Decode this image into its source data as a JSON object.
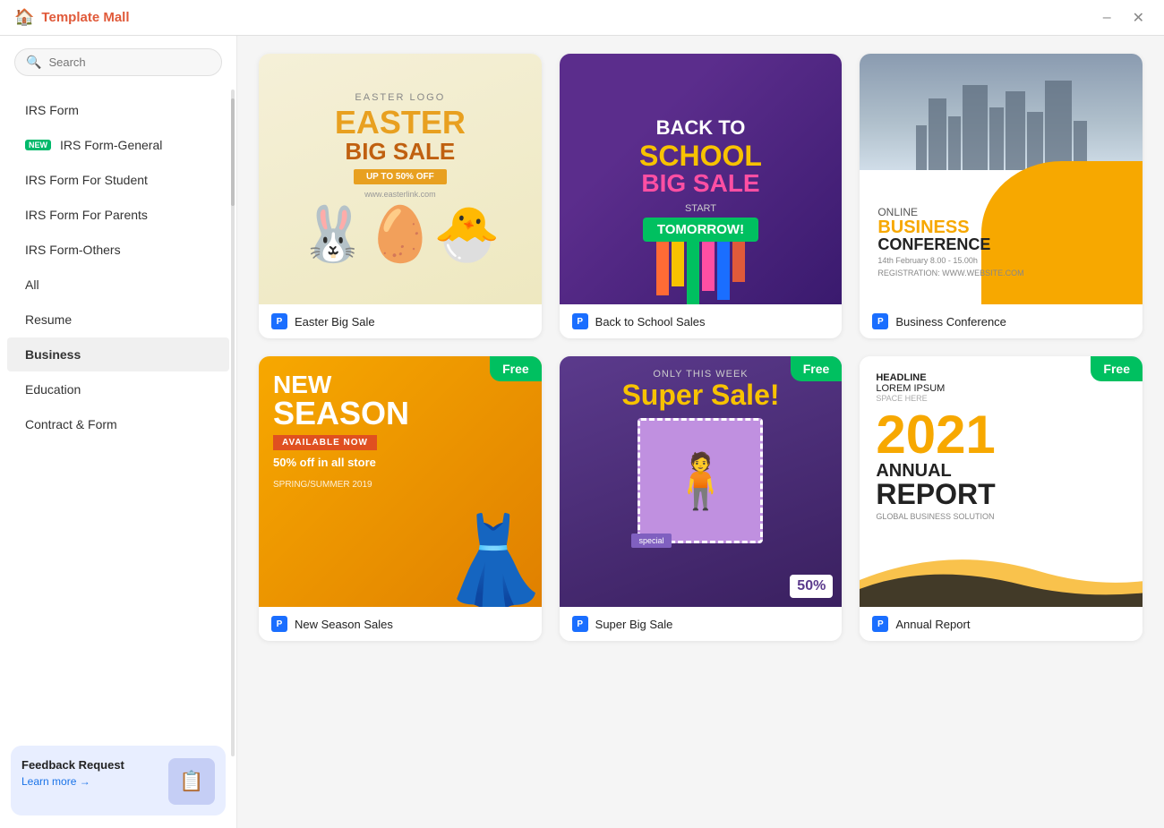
{
  "app": {
    "title": "Template Mall",
    "icon": "🏠"
  },
  "titlebar": {
    "minimize_label": "–",
    "close_label": "✕"
  },
  "search": {
    "placeholder": "Search"
  },
  "sidebar": {
    "items": [
      {
        "id": "irs-form",
        "label": "IRS Form",
        "badge": null
      },
      {
        "id": "irs-form-general",
        "label": "IRS Form-General",
        "badge": "new"
      },
      {
        "id": "irs-form-student",
        "label": "IRS Form For Student",
        "badge": null
      },
      {
        "id": "irs-form-parents",
        "label": "IRS Form For Parents",
        "badge": null
      },
      {
        "id": "irs-form-others",
        "label": "IRS Form-Others",
        "badge": null
      },
      {
        "id": "all",
        "label": "All",
        "badge": null
      },
      {
        "id": "resume",
        "label": "Resume",
        "badge": null
      },
      {
        "id": "business",
        "label": "Business",
        "badge": null,
        "active": true
      },
      {
        "id": "education",
        "label": "Education",
        "badge": null
      },
      {
        "id": "contract-form",
        "label": "Contract & Form",
        "badge": null
      }
    ],
    "feedback": {
      "title": "Feedback Request",
      "link_text": "Learn more →",
      "survey_label": "Survey"
    }
  },
  "templates": [
    {
      "id": "easter-big-sale",
      "name": "Easter Big Sale",
      "type": "easter",
      "free": false
    },
    {
      "id": "back-to-school-sales",
      "name": "Back to School Sales",
      "type": "school",
      "free": false
    },
    {
      "id": "business-conference",
      "name": "Business Conference",
      "type": "conference",
      "free": false
    },
    {
      "id": "new-season-sales",
      "name": "New Season Sales",
      "type": "season",
      "free": true
    },
    {
      "id": "super-big-sale",
      "name": "Super Big Sale",
      "type": "supersale",
      "free": true
    },
    {
      "id": "annual-report",
      "name": "Annual Report",
      "type": "annual",
      "free": true
    }
  ],
  "colors": {
    "brand_red": "#e05a3a",
    "accent_orange": "#f7a800",
    "accent_green": "#00c060",
    "accent_blue": "#1a6eff",
    "new_badge_bg": "#00b96b"
  }
}
